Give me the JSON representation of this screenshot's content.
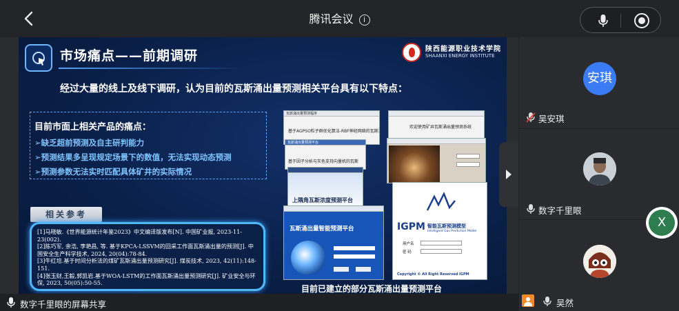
{
  "header": {
    "title": "腾讯会议"
  },
  "slide": {
    "title": "市场痛点——前期调研",
    "logo_cn": "陕西能源职业技术学院",
    "logo_en": "SHAANXI ENERGY INSTITUTE",
    "subtitle": "经过大量的线上及线下调研，认为目前的瓦斯涌出量预测相关平台具有以下特点：",
    "pain_title": "目前市面上相关产品的痛点：",
    "pain_items": [
      "➢缺乏超前预测及自主研判能力",
      "➢预测结果多呈现规定场景下的数值，无法实现动态预测",
      "➢预测参数无法实时匹配具体矿井的实际情况"
    ],
    "ref_tab": "相关参考",
    "refs": [
      "[1]马晓敏.《世界能源统计年鉴2023》中文编译版发布[N]. 中国矿业报, 2023-11-23(002).",
      "[2]陈巧军, 余浩, 李艳昌, 等. 基于KPCA-LSSVM的回采工作面瓦斯涌出量的预测[J]. 中国安全生产科学技术, 2024, 20(04):78-84.",
      "[3]牛红培.基于时间分析法的煤矿瓦斯涌出量预测研究[J]. 煤炭技术, 2023, 42(11):148-151.",
      "[4]张玉财,王毅,郭凯岩.基于WOA-LSTM的工作面瓦斯涌出量预测研究[J]. 矿业安全与环保, 2023, 50(05):50-55."
    ],
    "shots": {
      "s1_bar": "瓦斯涌出量预测程序",
      "s1_text": "基于AGPSO粒子群优化算法-RBF神经网络的瓦斯涌出量预测程序",
      "s2_text": "欢迎使用矿井瓦斯涌出量预测系统",
      "s3_bar": "瓦斯涌出量预测平台",
      "s3_text": "基于因子分析与灰色支持向量机的瓦斯",
      "s4_text": "上隅角瓦斯浓度预测平台",
      "s5_text": "瓦斯涌出量智能预测平台",
      "igpm_title": "IGPM",
      "igpm_cn": "智能瓦斯预测模型",
      "igpm_en": "Intelligent Gas Prediction Model",
      "igpm_user": "用户名",
      "igpm_pass": "密 码",
      "igpm_copy": "Copyright © All Right Reserved IGPM"
    },
    "shots_caption": "目前已建立的部分瓦斯涌出量预测平台"
  },
  "participants": [
    {
      "avatar_text": "安琪",
      "name": "吴安琪",
      "muted": true
    },
    {
      "avatar_text": "",
      "name": "数字千里眼",
      "muted": false
    },
    {
      "avatar_text": "",
      "name": "吴然",
      "muted": false
    }
  ],
  "x_button": "X",
  "bottom": {
    "label": "数字千里眼的屏幕共享"
  }
}
